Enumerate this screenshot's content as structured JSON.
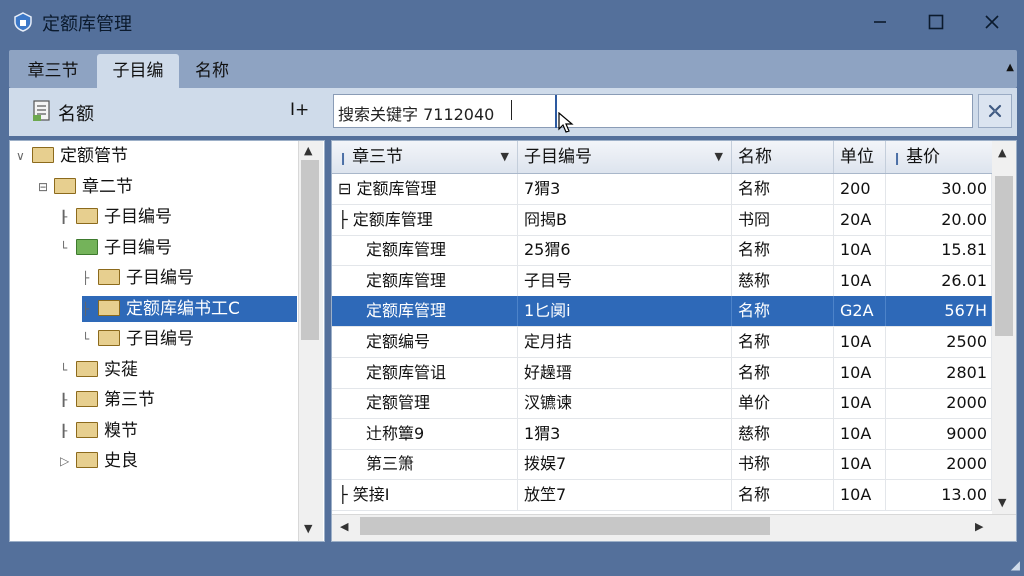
{
  "window": {
    "title": "定额库管理",
    "icon": "app-shield-icon",
    "controls": {
      "minimize": "minimize-icon",
      "maximize": "maximize-icon",
      "close": "close-icon"
    }
  },
  "tabs": [
    {
      "label": "章三节",
      "active": false
    },
    {
      "label": "子目编",
      "active": true
    },
    {
      "label": "名称",
      "active": false
    }
  ],
  "toolbar": {
    "label": "名额",
    "add_label": "I+",
    "search_value": "搜索关键字 7112040"
  },
  "tree": [
    {
      "label": "定额管节",
      "level": 0,
      "expander": "∨",
      "selected": false,
      "green": false
    },
    {
      "label": "章二节",
      "level": 1,
      "expander": "⊟",
      "selected": false,
      "green": false
    },
    {
      "label": "子目编号",
      "level": 2,
      "expander": "┠",
      "selected": false,
      "green": false
    },
    {
      "label": "子目编号",
      "level": 2,
      "expander": "└",
      "selected": false,
      "green": true
    },
    {
      "label": "子目编号",
      "level": 3,
      "expander": "├",
      "selected": false,
      "green": false
    },
    {
      "label": "定额库编书工C",
      "level": 3,
      "expander": "├",
      "selected": true,
      "green": false
    },
    {
      "label": "子目编号",
      "level": 3,
      "expander": "└",
      "selected": false,
      "green": false
    },
    {
      "label": "实蓰",
      "level": 2,
      "expander": "└",
      "selected": false,
      "green": false
    },
    {
      "label": "第三节",
      "level": 2,
      "expander": "┠",
      "selected": false,
      "green": false
    },
    {
      "label": "糗节",
      "level": 2,
      "expander": "┠",
      "selected": false,
      "green": false
    },
    {
      "label": "史良",
      "level": 2,
      "expander": "▷",
      "selected": false,
      "green": false
    }
  ],
  "grid": {
    "columns": [
      "章三节",
      "子目编号",
      "名称",
      "单位",
      "基价"
    ],
    "rows": [
      {
        "c": [
          "定额库管理",
          "7猬3",
          "名称",
          "200",
          "30.00"
        ],
        "prefix": "⊟ ",
        "selected": false
      },
      {
        "c": [
          "定额库管理",
          "冏揭B",
          "书冏",
          "20A",
          "20.00"
        ],
        "prefix": "├ ",
        "selected": false
      },
      {
        "c": [
          "定额库管理",
          "25猬6",
          "名称",
          "10A",
          "15.81"
        ],
        "prefix": "",
        "selected": false
      },
      {
        "c": [
          "定额库管理",
          "子目号",
          "慈称",
          "10A",
          "26.01"
        ],
        "prefix": "",
        "selected": false
      },
      {
        "c": [
          "定额库管理",
          "1匕阒i",
          "名称",
          "G2A",
          "567H"
        ],
        "prefix": "",
        "selected": true
      },
      {
        "c": [
          "定额编号",
          "定月拮",
          "名称",
          "10A",
          "2500"
        ],
        "prefix": "",
        "selected": false
      },
      {
        "c": [
          "定额库管诅",
          "好趮瑨",
          "名称",
          "10A",
          "2801"
        ],
        "prefix": "",
        "selected": false
      },
      {
        "c": [
          "定额管理",
          "汊镳谏",
          "单价",
          "10A",
          "2000"
        ],
        "prefix": "",
        "selected": false
      },
      {
        "c": [
          "辻称簟9",
          "1猬3",
          "慈称",
          "10A",
          "9000"
        ],
        "prefix": "",
        "selected": false
      },
      {
        "c": [
          "第三箫",
          "拨娱7",
          "书称",
          "10A",
          "2000"
        ],
        "prefix": "",
        "selected": false
      },
      {
        "c": [
          "笑接I",
          "放笁7",
          "名称",
          "10A",
          "13.00"
        ],
        "prefix": "├ ",
        "selected": false
      }
    ]
  },
  "colors": {
    "chrome": "#54709b",
    "panel": "#cfdbea",
    "selection": "#2e69b8"
  }
}
